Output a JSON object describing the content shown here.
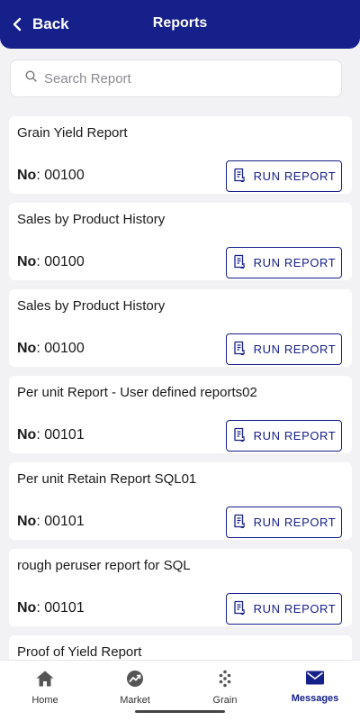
{
  "header": {
    "back_label": "Back",
    "title": "Reports"
  },
  "search": {
    "placeholder": "Search Report",
    "value": ""
  },
  "reports": [
    {
      "title": "Grain Yield Report",
      "no_label": "No",
      "no_value": ": 00100",
      "button": "RUN REPORT"
    },
    {
      "title": "Sales by Product History",
      "no_label": "No",
      "no_value": ": 00100",
      "button": "RUN REPORT"
    },
    {
      "title": "Sales by Product History",
      "no_label": "No",
      "no_value": ": 00100",
      "button": "RUN REPORT"
    },
    {
      "title": "Per unit Report - User defined reports02",
      "no_label": "No",
      "no_value": ": 00101",
      "button": "RUN REPORT"
    },
    {
      "title": "Per unit Retain Report SQL01",
      "no_label": "No",
      "no_value": ": 00101",
      "button": "RUN REPORT"
    },
    {
      "title": "rough peruser report for SQL",
      "no_label": "No",
      "no_value": ": 00101",
      "button": "RUN REPORT"
    },
    {
      "title": "Proof of Yield Report"
    }
  ],
  "nav": [
    {
      "label": "Home",
      "icon": "home-icon",
      "active": false
    },
    {
      "label": "Market",
      "icon": "market-icon",
      "active": false
    },
    {
      "label": "Grain",
      "icon": "grain-icon",
      "active": false
    },
    {
      "label": "Messages",
      "icon": "mail-icon",
      "active": true
    }
  ],
  "colors": {
    "primary": "#16208a",
    "background": "#f2f2f4",
    "card": "#ffffff"
  }
}
